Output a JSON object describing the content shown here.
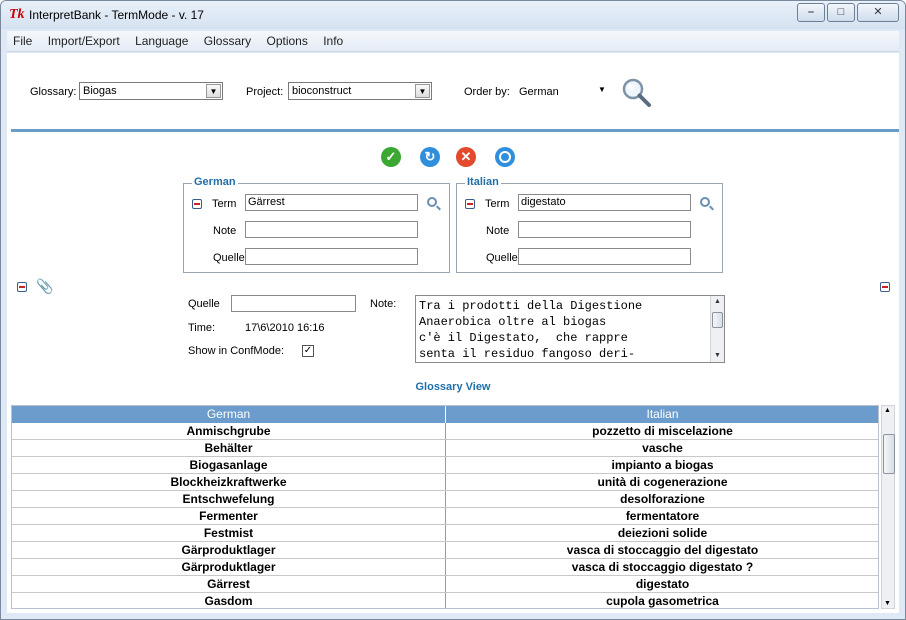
{
  "window": {
    "title": "InterpretBank - TermMode - v. 17",
    "app_icon": "Tk",
    "controls": [
      "minimize-icon",
      "maximize-icon",
      "close-icon"
    ]
  },
  "menu": [
    "File",
    "Import/Export",
    "Language",
    "Glossary",
    "Options",
    "Info"
  ],
  "toolbar": {
    "glossary_label": "Glossary:",
    "glossary_value": "Biogas",
    "project_label": "Project:",
    "project_value": "bioconstruct",
    "order_label": "Order by:",
    "order_value": "German",
    "search_icon": "search-icon"
  },
  "actions": [
    {
      "name": "confirm",
      "icon": "checkmark-icon",
      "color": "#3aa832"
    },
    {
      "name": "refresh",
      "icon": "refresh-icon",
      "color": "#2f8fdc"
    },
    {
      "name": "cancel",
      "icon": "cancel-icon",
      "color": "#e24a2b"
    },
    {
      "name": "target",
      "icon": "target-icon",
      "color": "#2f8fdc"
    }
  ],
  "german": {
    "title": "German",
    "term_label": "Term",
    "term_value": "Gärrest",
    "note_label": "Note",
    "note_value": "",
    "quelle_label": "Quelle",
    "quelle_value": ""
  },
  "italian": {
    "title": "Italian",
    "term_label": "Term",
    "term_value": "digestato",
    "note_label": "Note",
    "note_value": "",
    "quelle_label": "Quelle",
    "quelle_value": ""
  },
  "details": {
    "quelle_label": "Quelle",
    "quelle_value": "",
    "note_label": "Note:",
    "note_text": "Tra i prodotti della Digestione\nAnaerobica oltre al biogas\nc'è il Digestato,  che rappre\nsenta il residuo fangoso deri-",
    "time_label": "Time:",
    "time_value": "17\\6\\2010 16:16",
    "confmode_label": "Show in ConfMode:",
    "confmode_checked": "✓"
  },
  "glossary_view": {
    "title": "Glossary View",
    "columns": [
      "German",
      "Italian"
    ],
    "rows": [
      [
        "Anmischgrube",
        "pozzetto di miscelazione"
      ],
      [
        "Behälter",
        "vasche"
      ],
      [
        "Biogasanlage",
        "impianto a biogas"
      ],
      [
        "Blockheizkraftwerke",
        "unità di cogenerazione"
      ],
      [
        "Entschwefelung",
        "desolforazione"
      ],
      [
        "Fermenter",
        "fermentatore"
      ],
      [
        "Festmist",
        "deiezioni solide"
      ],
      [
        "Gärproduktlager",
        "vasca di stoccaggio del digestato"
      ],
      [
        "Gärproduktlager",
        "vasca di stoccaggio digestato ?"
      ],
      [
        "Gärrest",
        "digestato"
      ],
      [
        "Gasdom",
        "cupola gasometrica"
      ]
    ]
  },
  "colors": {
    "accent": "#1e6fa9",
    "header_bg": "#6b9ccb",
    "divider": "#6a9ccb"
  }
}
